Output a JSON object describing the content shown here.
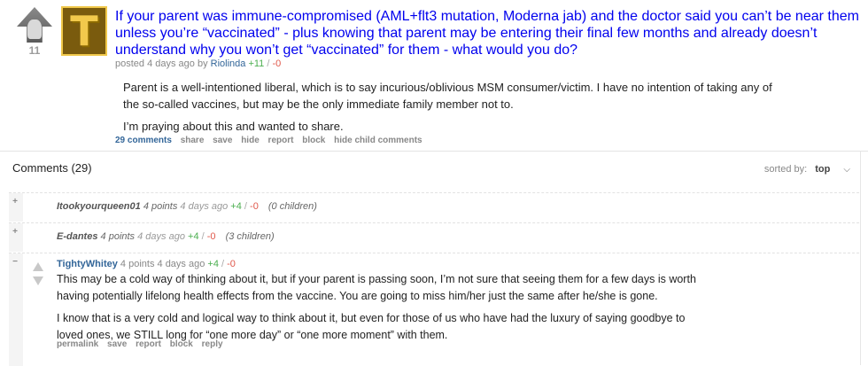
{
  "post": {
    "score": "11",
    "thumbnail_letter": "T",
    "title": "If your parent was immune-compromised (AML+flt3 mutation, Moderna jab) and the doctor said you can’t be near them unless you’re “vaccinated” - plus knowing that parent may be entering their final few months and already doesn’t understand why you won’t get “vaccinated” for them - what would you do?",
    "tagline": {
      "posted": "posted 4 days ago by",
      "author": "Riolinda",
      "up": "+11",
      "slash": "/",
      "down": "-0"
    },
    "selftext": [
      "Parent is a well-intentioned liberal, which is to say incurious/oblivious MSM consumer/victim. I have no intention of taking any of the so-called vaccines, but may be the only immediate family member not to.",
      "I’m praying about this and wanted to share."
    ],
    "buttons": {
      "comments": "29 comments",
      "share": "share",
      "save": "save",
      "hide": "hide",
      "report": "report",
      "block": "block",
      "hide_child": "hide child comments"
    }
  },
  "comments_header": {
    "title": "Comments (29)",
    "sorted_label": "sorted by:",
    "sorted_value": "top"
  },
  "comments": [
    {
      "toggle": "+",
      "author": "Itookyourqueen01",
      "points": "4 points",
      "time": "4 days ago",
      "up": "+4",
      "slash": "/",
      "down": "-0",
      "children": "(0 children)"
    },
    {
      "toggle": "+",
      "author": "E-dantes",
      "points": "4 points",
      "time": "4 days ago",
      "up": "+4",
      "slash": "/",
      "down": "-0",
      "children": "(3 children)"
    },
    {
      "toggle": "−",
      "author": "TightyWhitey",
      "points": "4 points",
      "time": "4 days ago",
      "up": "+4",
      "slash": "/",
      "down": "-0",
      "body": [
        "This may be a cold way of thinking about it, but if your parent is passing soon, I’m not sure that seeing them for a few days is worth having potentially lifelong health effects from the vaccine. You are going to miss him/her just the same after he/she is gone.",
        "I know that is a very cold and logical way to think about it, but even for those of us who have had the luxury of saying goodbye to loved ones, we STILL long for “one more day” or “one more moment” with them."
      ],
      "buttons": {
        "permalink": "permalink",
        "save": "save",
        "report": "report",
        "block": "block",
        "reply": "reply"
      }
    }
  ],
  "colors": {
    "title_link": "#0000ee",
    "author_link": "#336699",
    "upvote_green": "#4caf50",
    "downvote_red": "#e0584b"
  }
}
